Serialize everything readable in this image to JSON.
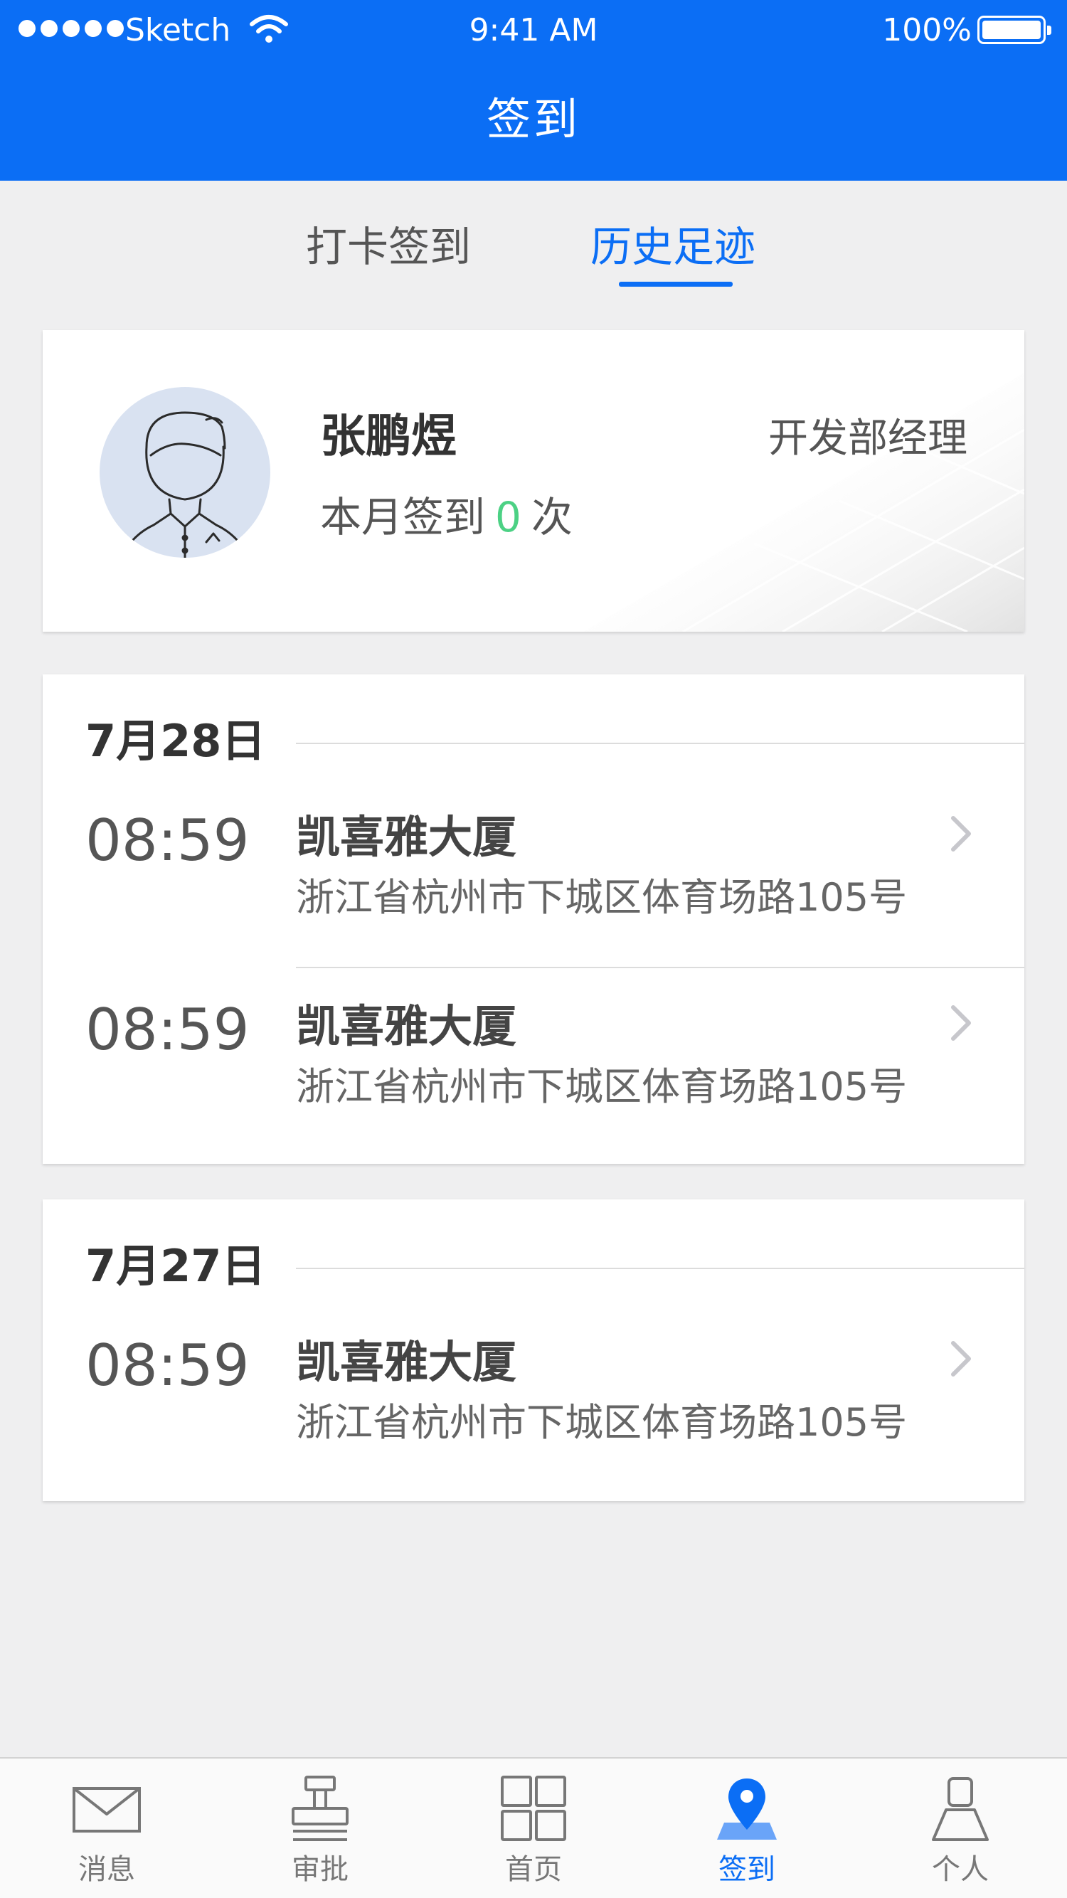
{
  "status_bar": {
    "carrier": "Sketch",
    "time": "9:41 AM",
    "battery": "100%"
  },
  "nav": {
    "title": "签到"
  },
  "tabs": [
    {
      "label": "打卡签到",
      "active": false
    },
    {
      "label": "历史足迹",
      "active": true
    }
  ],
  "profile": {
    "name": "张鹏煜",
    "role": "开发部经理",
    "monthly_prefix": "本月签到",
    "monthly_count": "0",
    "monthly_suffix": "次"
  },
  "history": [
    {
      "date": "7月28日",
      "records": [
        {
          "time": "08:59",
          "place": "凯喜雅大厦",
          "address": "浙江省杭州市下城区体育场路105号"
        },
        {
          "time": "08:59",
          "place": "凯喜雅大厦",
          "address": "浙江省杭州市下城区体育场路105号"
        }
      ]
    },
    {
      "date": "7月27日",
      "records": [
        {
          "time": "08:59",
          "place": "凯喜雅大厦",
          "address": "浙江省杭州市下城区体育场路105号"
        }
      ]
    }
  ],
  "tabbar": [
    {
      "label": "消息",
      "icon": "envelope-icon",
      "active": false
    },
    {
      "label": "审批",
      "icon": "stamp-icon",
      "active": false
    },
    {
      "label": "首页",
      "icon": "grid-icon",
      "active": false
    },
    {
      "label": "签到",
      "icon": "location-pin-icon",
      "active": true
    },
    {
      "label": "个人",
      "icon": "person-icon",
      "active": false
    }
  ],
  "colors": {
    "primary": "#0b6ef5",
    "count_green": "#4cd184",
    "background": "#efeff0",
    "inactive_icon": "#777777"
  }
}
